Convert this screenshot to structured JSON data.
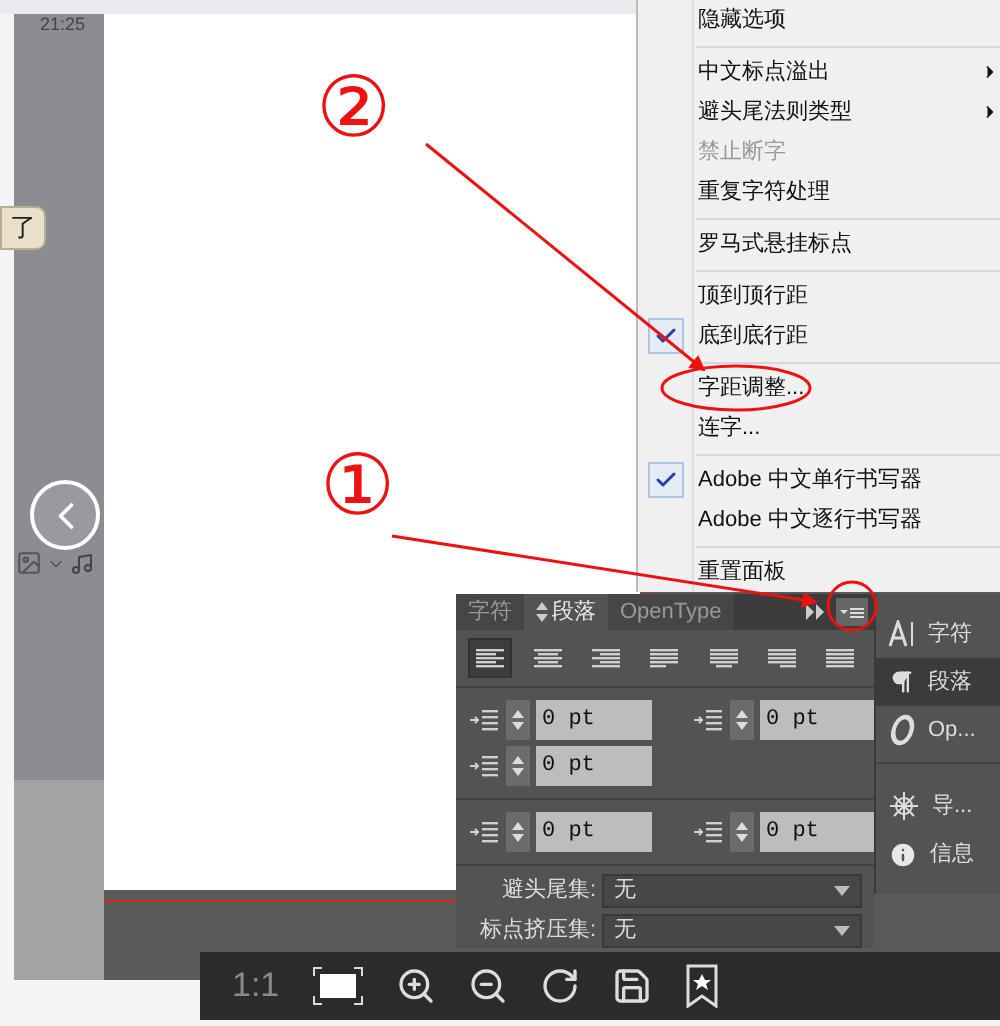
{
  "viewer": {
    "time": "21:25",
    "chat_text": "了",
    "zoom_label": "1:1"
  },
  "annotations": [
    {
      "label": "②"
    },
    {
      "label": "①"
    }
  ],
  "menu": {
    "items": [
      {
        "kind": "item",
        "label": "隐藏选项",
        "checked": false,
        "disabled": false,
        "submenu": false
      },
      {
        "kind": "separator"
      },
      {
        "kind": "item",
        "label": "中文标点溢出",
        "checked": false,
        "disabled": false,
        "submenu": true
      },
      {
        "kind": "item",
        "label": "避头尾法则类型",
        "checked": false,
        "disabled": false,
        "submenu": true
      },
      {
        "kind": "item",
        "label": "禁止断字",
        "checked": false,
        "disabled": true,
        "submenu": false
      },
      {
        "kind": "item",
        "label": "重复字符处理",
        "checked": false,
        "disabled": false,
        "submenu": false
      },
      {
        "kind": "separator"
      },
      {
        "kind": "item",
        "label": "罗马式悬挂标点",
        "checked": false,
        "disabled": false,
        "submenu": false
      },
      {
        "kind": "separator"
      },
      {
        "kind": "item",
        "label": "顶到顶行距",
        "checked": false,
        "disabled": false,
        "submenu": false
      },
      {
        "kind": "item",
        "label": "底到底行距",
        "checked": true,
        "disabled": false,
        "submenu": false
      },
      {
        "kind": "separator"
      },
      {
        "kind": "item",
        "label": "字距调整...",
        "checked": false,
        "disabled": false,
        "submenu": false
      },
      {
        "kind": "item",
        "label": "连字...",
        "checked": false,
        "disabled": false,
        "submenu": false
      },
      {
        "kind": "separator"
      },
      {
        "kind": "item",
        "label": "Adobe 中文单行书写器",
        "checked": true,
        "disabled": false,
        "submenu": false
      },
      {
        "kind": "item",
        "label": "Adobe 中文逐行书写器",
        "checked": false,
        "disabled": false,
        "submenu": false
      },
      {
        "kind": "separator"
      },
      {
        "kind": "item",
        "label": "重置面板",
        "checked": false,
        "disabled": false,
        "submenu": false
      }
    ]
  },
  "panel": {
    "tabs": [
      {
        "label": "字符",
        "selected": false
      },
      {
        "label": "段落",
        "selected": true
      },
      {
        "label": "OpenType",
        "selected": false
      }
    ],
    "alignment": [
      {
        "selected": true
      },
      {
        "selected": false
      },
      {
        "selected": false
      },
      {
        "selected": false
      },
      {
        "selected": false
      },
      {
        "selected": false
      },
      {
        "selected": false
      }
    ],
    "field_rows": [
      [
        {
          "value": "0 pt"
        },
        {
          "value": "0 pt"
        }
      ],
      [
        {
          "value": "0 pt"
        }
      ],
      [
        {
          "value": "0 pt"
        },
        {
          "value": "0 pt"
        }
      ]
    ],
    "dropdowns": [
      {
        "label": "避头尾集:",
        "value": "无"
      },
      {
        "label": "标点挤压集:",
        "value": "无"
      }
    ]
  },
  "dock": {
    "items": [
      {
        "kind": "character",
        "label": "字符",
        "selected": false
      },
      {
        "kind": "paragraph",
        "label": "段落",
        "selected": true
      },
      {
        "kind": "opentype",
        "label": "Op...",
        "selected": false
      },
      {
        "kind": "navigator",
        "label": "导...",
        "selected": false
      },
      {
        "kind": "info",
        "label": "信息",
        "selected": false
      }
    ]
  }
}
